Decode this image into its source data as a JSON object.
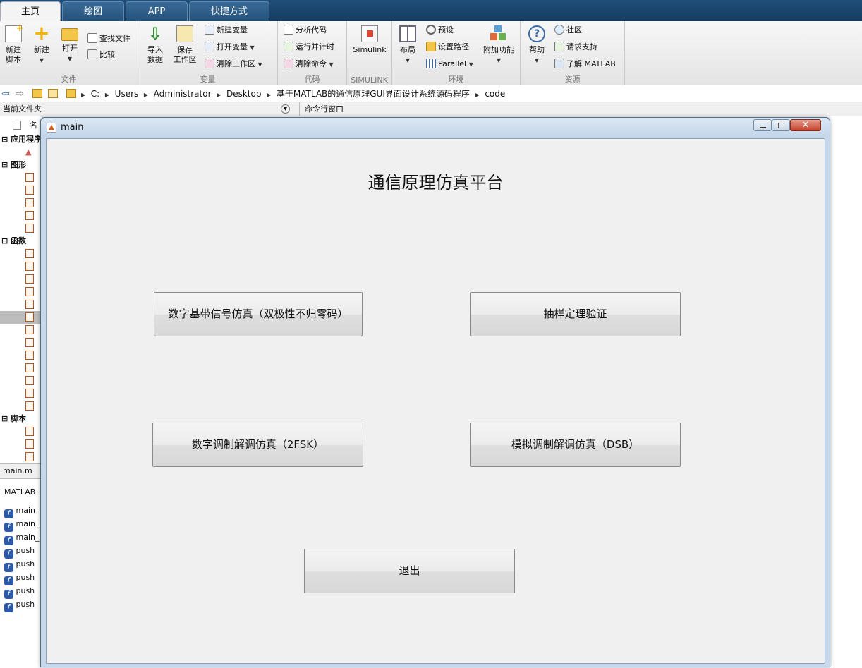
{
  "tabs": [
    {
      "label": "主页"
    },
    {
      "label": "绘图"
    },
    {
      "label": "APP"
    },
    {
      "label": "快捷方式"
    }
  ],
  "ribbon": {
    "file": {
      "new_script": "新建\n脚本",
      "new": "新建",
      "open": "打开",
      "find_files": "查找文件",
      "compare": "比较",
      "group": "文件"
    },
    "variable": {
      "import": "导入\n数据",
      "save": "保存\n工作区",
      "new_var": "新建变量",
      "open_var": "打开变量",
      "clear_ws": "清除工作区",
      "group": "变量"
    },
    "code": {
      "analyze": "分析代码",
      "run_time": "运行并计时",
      "clear_cmd": "清除命令",
      "group": "代码"
    },
    "simulink": {
      "btn": "Simulink",
      "group": "SIMULINK"
    },
    "env": {
      "layout": "布局",
      "prefs": "预设",
      "set_path": "设置路径",
      "parallel": "Parallel",
      "addons": "附加功能",
      "group": "环境"
    },
    "resources": {
      "help": "帮助",
      "community": "社区",
      "support": "请求支持",
      "learn": "了解 MATLAB",
      "group": "资源"
    }
  },
  "path": [
    "C:",
    "Users",
    "Administrator",
    "Desktop",
    "基于MATLAB的通信原理GUI界面设计系统源码程序",
    "code"
  ],
  "subbar": {
    "current_folder": "当前文件夹",
    "cmd_window": "命令行窗口"
  },
  "left": {
    "name_header": "名",
    "sections": {
      "apps": "应用程序",
      "figs": "图形",
      "funcs": "函数",
      "scripts": "脚本"
    },
    "tab": "main.m",
    "matlab_label": "MATLAB",
    "funcs_list": [
      "main",
      "main_",
      "main_",
      "push",
      "push",
      "push",
      "push",
      "push"
    ]
  },
  "window": {
    "title": "main",
    "heading": "通信原理仿真平台",
    "buttons": {
      "baseband": "数字基带信号仿真（双极性不归零码）",
      "sampling": "抽样定理验证",
      "fsk": "数字调制解调仿真（2FSK）",
      "dsb": "模拟调制解调仿真（DSB）",
      "exit": "退出"
    }
  },
  "colors": {
    "tabbar": "#1f4e7a",
    "client_bg": "#f0f0f0",
    "title_bar": "#c3d6ea"
  }
}
